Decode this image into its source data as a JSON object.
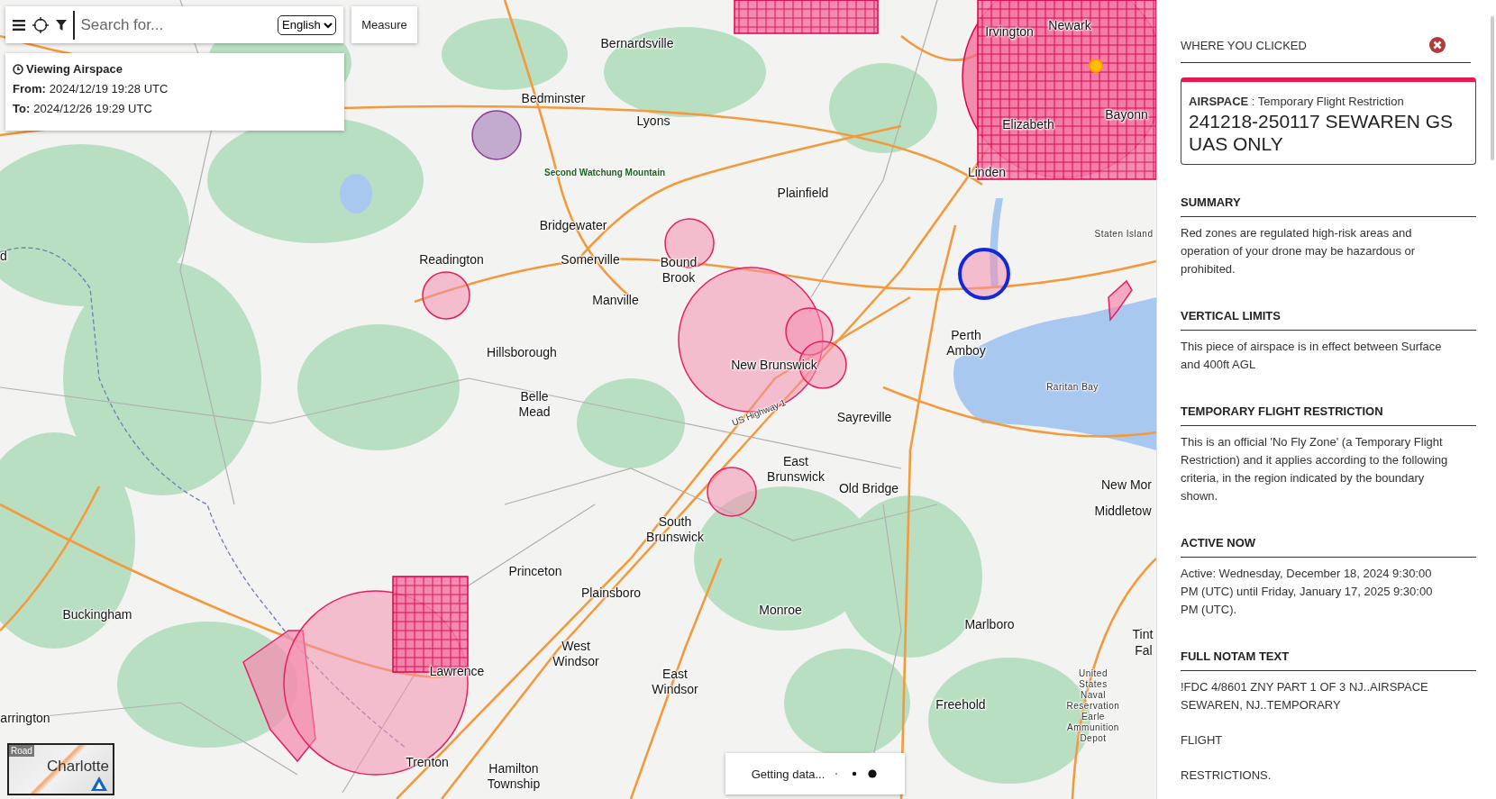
{
  "toolbar": {
    "search": {
      "placeholder": "Search for..."
    },
    "language": "English",
    "measure_button": "Measure"
  },
  "viewing": {
    "title": "Viewing Airspace",
    "from_label": "From:",
    "from": "2024/12/19 19:28 UTC",
    "to_label": "To:",
    "to": "2024/12/26 19:29 UTC"
  },
  "map": {
    "labels": [
      {
        "text": "Newark",
        "kind": "town"
      },
      {
        "text": "Irvington",
        "kind": "town"
      },
      {
        "text": "Bernardsville",
        "kind": "town"
      },
      {
        "text": "Bedminster",
        "kind": "town"
      },
      {
        "text": "Bayonn",
        "kind": "town"
      },
      {
        "text": "Lyons",
        "kind": "town"
      },
      {
        "text": "Elizabeth",
        "kind": "town"
      },
      {
        "text": "Second Watchung Mountain",
        "kind": "feature"
      },
      {
        "text": "Linden",
        "kind": "town"
      },
      {
        "text": "Plainfield",
        "kind": "town"
      },
      {
        "text": "Bridgewater",
        "kind": "town"
      },
      {
        "text": "Staten Island",
        "kind": "small"
      },
      {
        "text": "d",
        "kind": "town"
      },
      {
        "text": "Readington",
        "kind": "town"
      },
      {
        "text": "Somerville",
        "kind": "town"
      },
      {
        "text": "Bound Brook",
        "kind": "town"
      },
      {
        "text": "Manville",
        "kind": "town"
      },
      {
        "text": "Hillsborough",
        "kind": "town"
      },
      {
        "text": "New Brunswick",
        "kind": "town"
      },
      {
        "text": "Perth Amboy",
        "kind": "town"
      },
      {
        "text": "Raritan Bay",
        "kind": "small"
      },
      {
        "text": "Belle Mead",
        "kind": "town"
      },
      {
        "text": "US Highway 1",
        "kind": "road"
      },
      {
        "text": "Sayreville",
        "kind": "town"
      },
      {
        "text": "East Brunswick",
        "kind": "town"
      },
      {
        "text": "New Mor",
        "kind": "town"
      },
      {
        "text": "Old Bridge",
        "kind": "town"
      },
      {
        "text": "Middletow",
        "kind": "town"
      },
      {
        "text": "South Brunswick",
        "kind": "town"
      },
      {
        "text": "Princeton",
        "kind": "town"
      },
      {
        "text": "Plainsboro",
        "kind": "town"
      },
      {
        "text": "Monroe",
        "kind": "town"
      },
      {
        "text": "Buckingham",
        "kind": "town"
      },
      {
        "text": "Marlboro",
        "kind": "town"
      },
      {
        "text": "Tint",
        "kind": "town"
      },
      {
        "text": "Fal",
        "kind": "town"
      },
      {
        "text": "West Windsor",
        "kind": "town"
      },
      {
        "text": "Lawrence",
        "kind": "town"
      },
      {
        "text": "East Windsor",
        "kind": "town"
      },
      {
        "text": "Freehold",
        "kind": "town"
      },
      {
        "text": "United States Naval Reservation Earle Ammunition Depot",
        "kind": "small"
      },
      {
        "text": "arrington",
        "kind": "town"
      },
      {
        "text": "Trenton",
        "kind": "town"
      },
      {
        "text": "Hamilton Township",
        "kind": "town"
      }
    ],
    "zones": [
      {
        "kind": "advisory",
        "selected": false
      },
      {
        "kind": "restricted",
        "selected": false
      },
      {
        "kind": "restricted",
        "selected": false
      },
      {
        "kind": "restricted",
        "selected": false
      },
      {
        "kind": "restricted",
        "selected": false
      },
      {
        "kind": "restricted",
        "selected": false
      },
      {
        "kind": "restricted",
        "selected": false
      },
      {
        "kind": "restricted",
        "selected": true
      },
      {
        "kind": "restricted",
        "selected": false
      },
      {
        "kind": "grid",
        "selected": false
      },
      {
        "kind": "grid",
        "selected": false
      },
      {
        "kind": "grid",
        "selected": false
      },
      {
        "kind": "restricted",
        "selected": false
      }
    ]
  },
  "basemap": {
    "style": "Road",
    "place": "Charlotte"
  },
  "status": {
    "text": "Getting data..."
  },
  "panel": {
    "header": "WHERE YOU CLICKED",
    "card": {
      "category": "**AIRSPACE** : Temporary Flight Restriction",
      "title": "241218-250117 SEWAREN GS UAS ONLY"
    },
    "sections": [
      {
        "heading": "SUMMARY",
        "paragraphs": [
          "Red zones are regulated high-risk areas and operation of your drone may be hazardous or prohibited."
        ]
      },
      {
        "heading": "VERTICAL LIMITS",
        "paragraphs": [
          "This piece of airspace is in effect between Surface and 400ft AGL"
        ]
      },
      {
        "heading": "TEMPORARY FLIGHT RESTRICTION",
        "paragraphs": [
          "This is an official 'No Fly Zone' (a Temporary Flight Restriction) and it applies according to the following criteria, in the region indicated by the boundary shown."
        ]
      },
      {
        "heading": "ACTIVE NOW",
        "paragraphs": [
          "Active: Wednesday, December 18, 2024 9:30:00 PM (UTC) until Friday, January 17, 2025 9:30:00 PM (UTC)."
        ]
      },
      {
        "heading": "FULL NOTAM TEXT",
        "paragraphs": [
          "!FDC 4/8601 ZNY PART 1 OF 3 NJ..AIRSPACE SEWAREN, NJ..TEMPORARY",
          "FLIGHT",
          "RESTRICTIONS."
        ]
      }
    ]
  }
}
